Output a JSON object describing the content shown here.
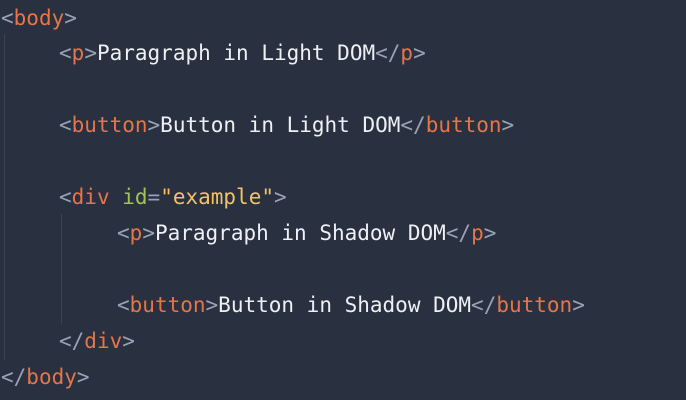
{
  "lines": [
    {
      "tag": "body"
    },
    {
      "tag": "p",
      "text": "Paragraph in Light DOM",
      "close": "p"
    },
    {
      "tag": "button",
      "text": "Button in Light DOM",
      "close": "button"
    },
    {
      "tag": "div",
      "attr": "id",
      "eq": "=",
      "value": "\"example\""
    },
    {
      "tag": "p",
      "text": "Paragraph in Shadow DOM",
      "close": "p"
    },
    {
      "tag": "button",
      "text": "Button in Shadow DOM",
      "close": "button"
    },
    {
      "close": "div"
    },
    {
      "close": "body"
    }
  ],
  "syntax_colors": {
    "background": "#293040",
    "punctuation": "#9aa3b5",
    "tag": "#e5754a",
    "attribute": "#a0c25d",
    "string": "#f2c26b",
    "text": "#eef0f4"
  }
}
